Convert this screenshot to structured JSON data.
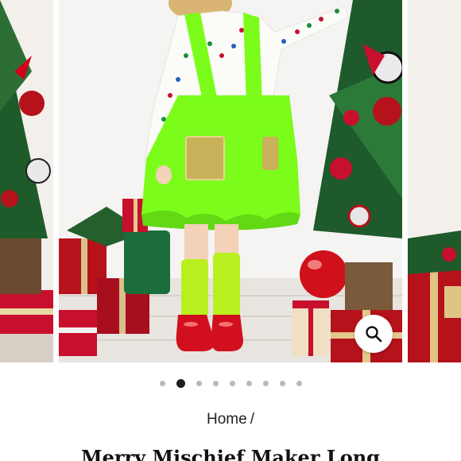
{
  "gallery": {
    "slide_count": 9,
    "active_index": 1,
    "zoom_icon": "magnifier-icon"
  },
  "breadcrumb": {
    "home_label": "Home",
    "separator": "/"
  },
  "product": {
    "title": "Merry Mischief Maker Long"
  },
  "colors": {
    "tutu_green": "#7CFC1A",
    "accent_red": "#C8102E",
    "dot_active": "#1E1E1E",
    "dot_inactive": "#B9B9B9"
  }
}
